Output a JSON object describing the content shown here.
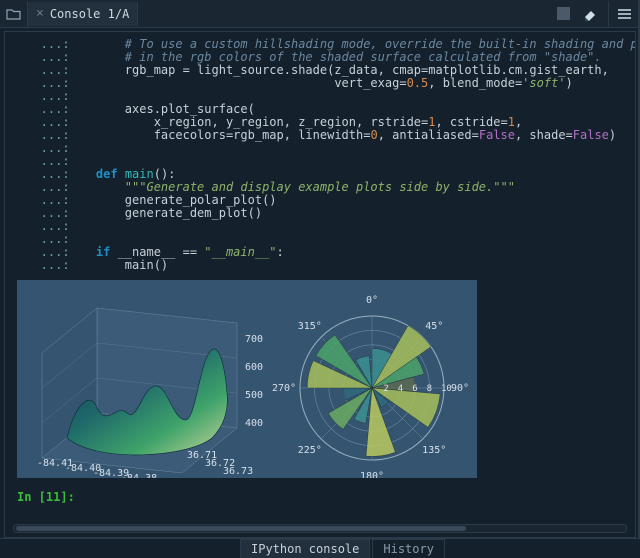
{
  "tab_title": "Console 1/A",
  "bottom_tabs": {
    "active": "IPython console",
    "inactive": "History"
  },
  "prompt_label": "In [11]:",
  "gutter": "...:",
  "code_lines": [
    {
      "indent": "        ",
      "parts": [
        {
          "cls": "c-comment",
          "t": "# To use a custom hillshading mode, override the built-in shading and pass"
        }
      ]
    },
    {
      "indent": "        ",
      "parts": [
        {
          "cls": "c-comment",
          "t": "# in the rgb colors of the shaded surface calculated from \"shade\"."
        }
      ]
    },
    {
      "indent": "        ",
      "parts": [
        {
          "cls": "c-id",
          "t": "rgb_map = light_source.shade(z_data, cmap=matplotlib.cm.gist_earth,"
        }
      ]
    },
    {
      "indent": "                                     ",
      "parts": [
        {
          "cls": "c-id",
          "t": "vert_exag="
        },
        {
          "cls": "c-num",
          "t": "0.5"
        },
        {
          "cls": "c-id",
          "t": ", blend_mode="
        },
        {
          "cls": "c-str",
          "t": "'soft'"
        },
        {
          "cls": "c-id",
          "t": ")"
        }
      ]
    },
    {
      "indent": "",
      "parts": []
    },
    {
      "indent": "        ",
      "parts": [
        {
          "cls": "c-id",
          "t": "axes.plot_surface("
        }
      ]
    },
    {
      "indent": "            ",
      "parts": [
        {
          "cls": "c-id",
          "t": "x_region, y_region, z_region, rstride="
        },
        {
          "cls": "c-num",
          "t": "1"
        },
        {
          "cls": "c-id",
          "t": ", cstride="
        },
        {
          "cls": "c-num",
          "t": "1"
        },
        {
          "cls": "c-id",
          "t": ","
        }
      ]
    },
    {
      "indent": "            ",
      "parts": [
        {
          "cls": "c-id",
          "t": "facecolors=rgb_map, linewidth="
        },
        {
          "cls": "c-num",
          "t": "0"
        },
        {
          "cls": "c-id",
          "t": ", antialiased="
        },
        {
          "cls": "c-const",
          "t": "False"
        },
        {
          "cls": "c-id",
          "t": ", shade="
        },
        {
          "cls": "c-const",
          "t": "False"
        },
        {
          "cls": "c-id",
          "t": ")"
        }
      ]
    },
    {
      "indent": "",
      "parts": []
    },
    {
      "indent": "",
      "parts": []
    },
    {
      "indent": "    ",
      "parts": [
        {
          "cls": "c-kw",
          "t": "def "
        },
        {
          "cls": "c-fn",
          "t": "main"
        },
        {
          "cls": "c-id",
          "t": "():"
        }
      ]
    },
    {
      "indent": "        ",
      "parts": [
        {
          "cls": "c-docstr",
          "t": "\"\"\"Generate and display example plots side by side.\"\"\""
        }
      ]
    },
    {
      "indent": "        ",
      "parts": [
        {
          "cls": "c-id",
          "t": "generate_polar_plot()"
        }
      ]
    },
    {
      "indent": "        ",
      "parts": [
        {
          "cls": "c-id",
          "t": "generate_dem_plot()"
        }
      ]
    },
    {
      "indent": "",
      "parts": []
    },
    {
      "indent": "",
      "parts": []
    },
    {
      "indent": "    ",
      "parts": [
        {
          "cls": "c-kw",
          "t": "if"
        },
        {
          "cls": "c-id",
          "t": " __name__ == "
        },
        {
          "cls": "c-str",
          "t": "\"__main__\""
        },
        {
          "cls": "c-id",
          "t": ":"
        }
      ]
    },
    {
      "indent": "        ",
      "parts": [
        {
          "cls": "c-id",
          "t": "main()"
        }
      ]
    }
  ],
  "chart_data": [
    {
      "type": "surface3d",
      "title": "",
      "x_ticks": [
        "-84.41",
        "-84.40",
        "-84.39",
        "-84.38"
      ],
      "y_ticks": [
        "36.71",
        "36.72",
        "36.73"
      ],
      "z_ticks": [
        "400",
        "500",
        "600",
        "700"
      ],
      "z_range": [
        350,
        750
      ],
      "colormap": "gist_earth",
      "note": "Hillshaded DEM surface; shape is irregular terrain, values estimated from tick labels."
    },
    {
      "type": "polar_bar",
      "title": "",
      "angle_labels_deg": [
        0,
        45,
        90,
        135,
        180,
        225,
        270,
        315
      ],
      "radial_ticks": [
        2,
        4,
        6,
        8,
        10
      ],
      "r_max": 10,
      "bars": [
        {
          "theta_deg": 0,
          "width_deg": 30,
          "r": 5.5,
          "color": "#3a8f8f"
        },
        {
          "theta_deg": 30,
          "width_deg": 25,
          "r": 10,
          "color": "#a6c05a"
        },
        {
          "theta_deg": 55,
          "width_deg": 20,
          "r": 7.5,
          "color": "#4aa36a"
        },
        {
          "theta_deg": 75,
          "width_deg": 20,
          "r": 6,
          "color": "#5c6a52"
        },
        {
          "theta_deg": 95,
          "width_deg": 30,
          "r": 9.5,
          "color": "#a6c05a"
        },
        {
          "theta_deg": 130,
          "width_deg": 25,
          "r": 3,
          "color": "#2f6a7a"
        },
        {
          "theta_deg": 160,
          "width_deg": 25,
          "r": 9.5,
          "color": "#b8c95e"
        },
        {
          "theta_deg": 190,
          "width_deg": 20,
          "r": 5,
          "color": "#3a8f8f"
        },
        {
          "theta_deg": 215,
          "width_deg": 25,
          "r": 7,
          "color": "#6aab62"
        },
        {
          "theta_deg": 245,
          "width_deg": 25,
          "r": 4,
          "color": "#2f6a7a"
        },
        {
          "theta_deg": 270,
          "width_deg": 25,
          "r": 9,
          "color": "#a6c05a"
        },
        {
          "theta_deg": 300,
          "width_deg": 25,
          "r": 9,
          "color": "#4aa36a"
        },
        {
          "theta_deg": 330,
          "width_deg": 25,
          "r": 4.5,
          "color": "#3a8f8f"
        }
      ]
    }
  ]
}
